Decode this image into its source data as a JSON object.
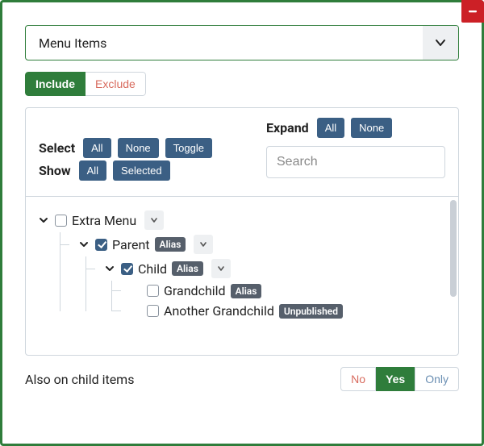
{
  "dropdown": {
    "label": "Menu Items"
  },
  "mode": {
    "include": "Include",
    "exclude": "Exclude",
    "active": "include"
  },
  "controls": {
    "select": {
      "label": "Select",
      "all": "All",
      "none": "None",
      "toggle": "Toggle"
    },
    "show": {
      "label": "Show",
      "all": "All",
      "selected": "Selected"
    },
    "expand": {
      "label": "Expand",
      "all": "All",
      "none": "None"
    },
    "search_placeholder": "Search"
  },
  "tree": {
    "root": {
      "label": "Extra Menu",
      "checked": false,
      "expanded": true,
      "children": [
        {
          "label": "Parent",
          "badge": "Alias",
          "checked": true,
          "expanded": true,
          "children": [
            {
              "label": "Child",
              "badge": "Alias",
              "checked": true,
              "expanded": true,
              "children": [
                {
                  "label": "Grandchild",
                  "badge": "Alias",
                  "checked": false
                },
                {
                  "label": "Another Grandchild",
                  "badge": "Unpublished",
                  "checked": false
                }
              ]
            }
          ]
        }
      ]
    }
  },
  "footer": {
    "label": "Also on child items",
    "options": {
      "no": "No",
      "yes": "Yes",
      "only": "Only"
    },
    "active": "yes"
  }
}
